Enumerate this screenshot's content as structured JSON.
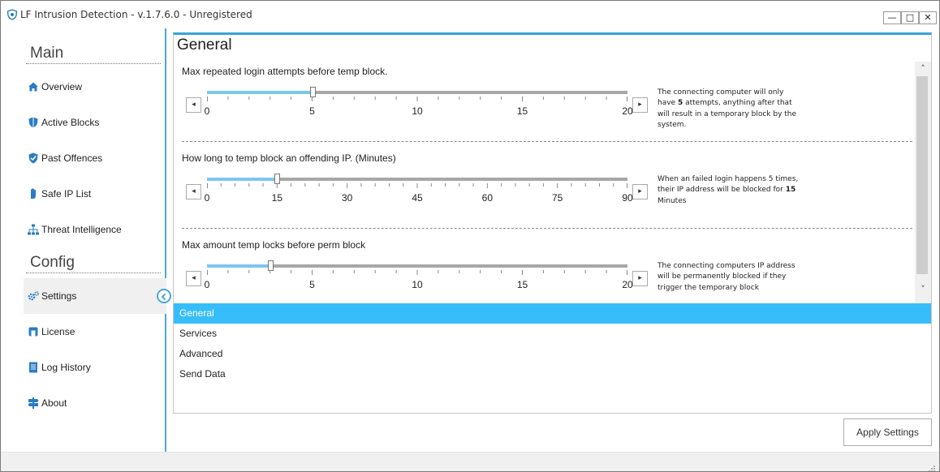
{
  "window": {
    "title": "LF Intrusion Detection - v.1.7.6.0 - Unregistered",
    "controls": {
      "minimize": "—",
      "maximize": "□",
      "close": "✕"
    }
  },
  "sidebar": {
    "main_title": "Main",
    "config_title": "Config",
    "main_items": [
      {
        "label": "Overview",
        "icon": "home-icon"
      },
      {
        "label": "Active Blocks",
        "icon": "shield-icon"
      },
      {
        "label": "Past Offences",
        "icon": "shield-check-icon"
      },
      {
        "label": "Safe IP List",
        "icon": "hand-icon"
      },
      {
        "label": "Threat Intelligence",
        "icon": "network-icon"
      }
    ],
    "config_items": [
      {
        "label": "Settings",
        "icon": "gear-icon",
        "active": true
      },
      {
        "label": "License",
        "icon": "license-icon"
      },
      {
        "label": "Log History",
        "icon": "document-icon"
      },
      {
        "label": "About",
        "icon": "signpost-icon"
      }
    ]
  },
  "main": {
    "heading": "General",
    "settings": [
      {
        "title": "Max repeated login attempts before temp block.",
        "min": 0,
        "max": 20,
        "value": 5,
        "ticks": [
          "0",
          "5",
          "10",
          "15",
          "20"
        ],
        "description": {
          "before": "The connecting computer will only have ",
          "value": "5",
          "after": " attempts, anything after that will result in a temporary block by the system."
        }
      },
      {
        "title": "How long to temp block an offending IP. (Minutes)",
        "min": 0,
        "max": 90,
        "value": 15,
        "ticks": [
          "0",
          "15",
          "30",
          "45",
          "60",
          "75",
          "90"
        ],
        "description": {
          "before": "When an failed login happens 5 times, their IP address will be blocked for ",
          "value": "15",
          "after": " Minutes"
        }
      },
      {
        "title": "Max amount temp locks before perm block",
        "min": 0,
        "max": 20,
        "value": 3,
        "ticks": [
          "0",
          "5",
          "10",
          "15",
          "20"
        ],
        "description": {
          "before": "The connecting computers IP address will be permanently blocked if they trigger the temporary block",
          "value": "",
          "after": ""
        }
      }
    ],
    "arrows": {
      "left": "◂",
      "right": "▸"
    },
    "scroll": {
      "up": "˄",
      "down": "˅"
    },
    "tabs": [
      {
        "label": "General",
        "selected": true
      },
      {
        "label": "Services"
      },
      {
        "label": "Advanced"
      },
      {
        "label": "Send Data"
      }
    ],
    "apply_button": "Apply Settings"
  },
  "colors": {
    "accent": "#37bdf9",
    "slider_fill": "#7cc7ee",
    "sidebar_border": "#4aa8d8"
  }
}
